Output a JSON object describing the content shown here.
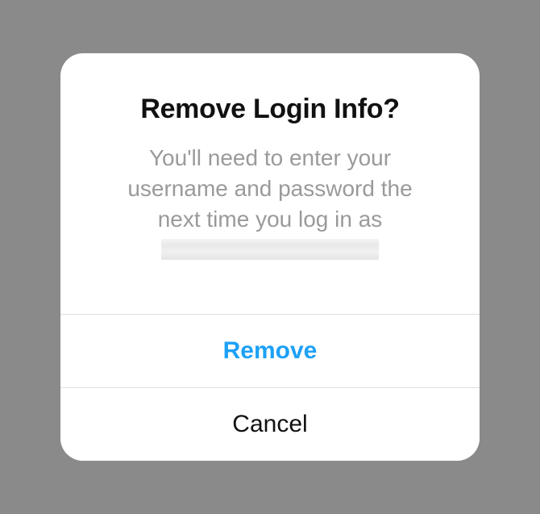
{
  "dialog": {
    "title": "Remove Login Info?",
    "message_line1": "You'll need to enter your",
    "message_line2": "username and password the",
    "message_line3": "next time you log in as",
    "remove_label": "Remove",
    "cancel_label": "Cancel"
  }
}
